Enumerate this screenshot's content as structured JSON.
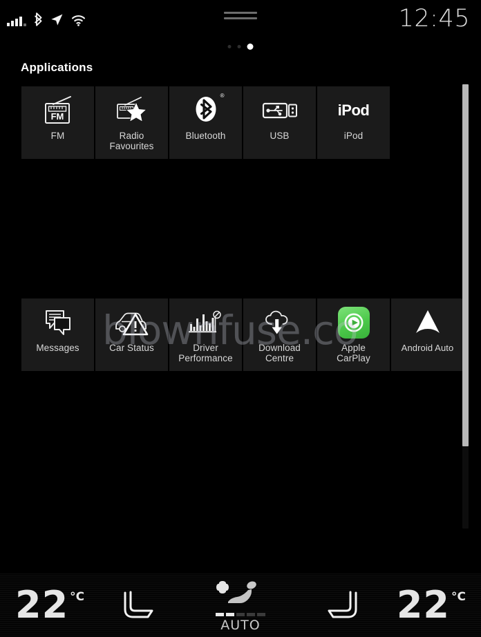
{
  "status_bar": {
    "clock": "12:45",
    "icons": [
      {
        "name": "signal-strength-icon",
        "label": "signal"
      },
      {
        "name": "bluetooth-status-icon",
        "label": "bluetooth"
      },
      {
        "name": "navigation-arrow-icon",
        "label": "navigation"
      },
      {
        "name": "wifi-icon",
        "label": "wifi"
      }
    ],
    "drag_handle": "drag-handle"
  },
  "pagination": {
    "dots": 3,
    "active_index": 2
  },
  "header": {
    "title": "Applications"
  },
  "rows": [
    {
      "tiles": [
        {
          "label": "FM",
          "icon": "fm-radio-icon",
          "glyph_text": "FM"
        },
        {
          "label": "Radio\nFavourites",
          "icon": "radio-favourites-icon"
        },
        {
          "label": "Bluetooth",
          "icon": "bluetooth-icon",
          "badge": "®"
        },
        {
          "label": "USB",
          "icon": "usb-icon"
        },
        {
          "label": "iPod",
          "icon": "ipod-icon",
          "glyph_text": "iPod"
        }
      ]
    },
    {
      "tiles": [
        {
          "label": "Messages",
          "icon": "messages-icon"
        },
        {
          "label": "Car Status",
          "icon": "car-status-icon"
        },
        {
          "label": "Driver\nPerformance",
          "icon": "driver-performance-icon"
        },
        {
          "label": "Download\nCentre",
          "icon": "download-centre-icon"
        },
        {
          "label": "Apple\nCarPlay",
          "icon": "apple-carplay-icon"
        },
        {
          "label": "Android Auto",
          "icon": "android-auto-icon"
        }
      ]
    }
  ],
  "watermark": {
    "text": "blownfuse.co"
  },
  "scrollbar": {
    "orientation": "vertical"
  },
  "climate": {
    "left_temp": {
      "value": "22",
      "unit": "°C"
    },
    "right_temp": {
      "value": "22",
      "unit": "°C"
    },
    "left_seat": "driver-seat-icon",
    "right_seat": "passenger-seat-icon",
    "auto": {
      "label": "AUTO",
      "levels_total": 5,
      "levels_on": 2
    }
  },
  "colors": {
    "background": "#000000",
    "tile_bg": "#1b1b1b",
    "text": "#d8d8d8",
    "carplay_green": "#4cc84a",
    "scrollbar_thumb": "#b9b9b9"
  }
}
